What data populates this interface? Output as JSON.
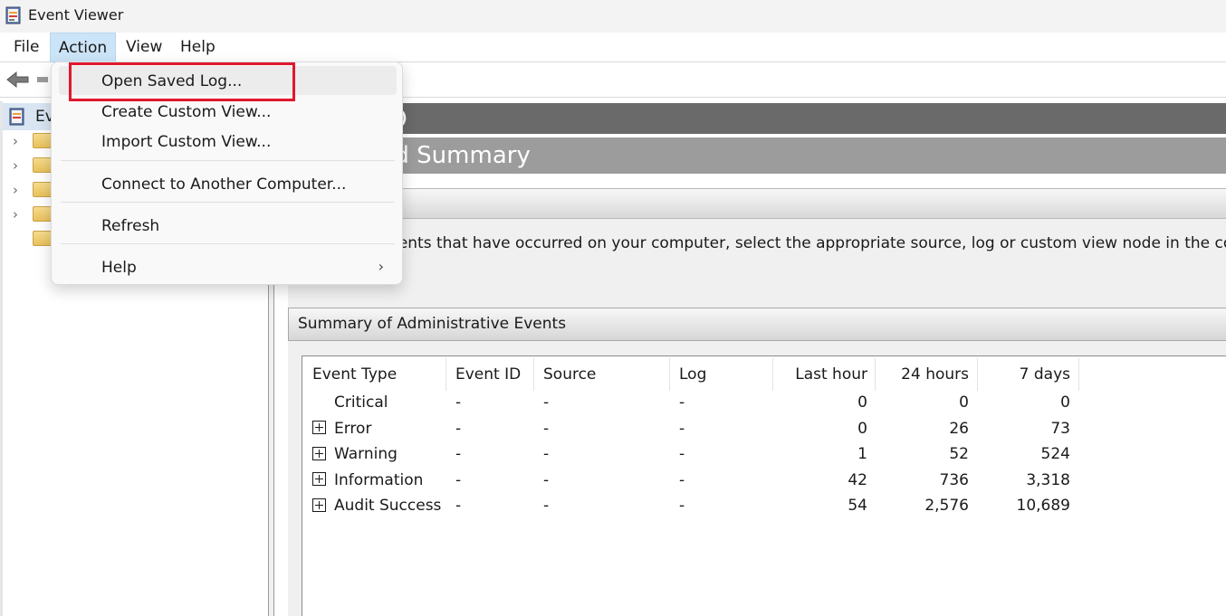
{
  "window": {
    "title": "Event Viewer"
  },
  "menubar": {
    "items": [
      "File",
      "Action",
      "View",
      "Help"
    ]
  },
  "tree": {
    "root_label": "Ev"
  },
  "content": {
    "header_text": "ocal)",
    "subheader_text": "and Summary",
    "overview_text": "w events that have occurred on your computer, select the appropriate source, log or custom view node in the conso",
    "summary_title": "Summary of Administrative Events",
    "table": {
      "columns": [
        "Event Type",
        "Event ID",
        "Source",
        "Log",
        "Last hour",
        "24 hours",
        "7 days"
      ],
      "rows": [
        {
          "type": "Critical",
          "id": "-",
          "source": "-",
          "log": "-",
          "last_hour": "0",
          "h24": "0",
          "d7": "0",
          "expandable": false
        },
        {
          "type": "Error",
          "id": "-",
          "source": "-",
          "log": "-",
          "last_hour": "0",
          "h24": "26",
          "d7": "73",
          "expandable": true
        },
        {
          "type": "Warning",
          "id": "-",
          "source": "-",
          "log": "-",
          "last_hour": "1",
          "h24": "52",
          "d7": "524",
          "expandable": true
        },
        {
          "type": "Information",
          "id": "-",
          "source": "-",
          "log": "-",
          "last_hour": "42",
          "h24": "736",
          "d7": "3,318",
          "expandable": true
        },
        {
          "type": "Audit Success",
          "id": "-",
          "source": "-",
          "log": "-",
          "last_hour": "54",
          "h24": "2,576",
          "d7": "10,689",
          "expandable": true
        }
      ]
    }
  },
  "action_menu": {
    "items": [
      {
        "label": "Open Saved Log...",
        "highlighted": true
      },
      {
        "label": "Create Custom View..."
      },
      {
        "label": "Import Custom View..."
      },
      {
        "label": "Connect to Another Computer..."
      },
      {
        "label": "Refresh"
      },
      {
        "label": "Help",
        "submenu_arrow": "›"
      }
    ]
  },
  "colors": {
    "menu_active": "#cce4f7",
    "highlight_border": "#e0182d",
    "header_dark": "#6a6a6a",
    "header_mid": "#9c9c9c"
  }
}
